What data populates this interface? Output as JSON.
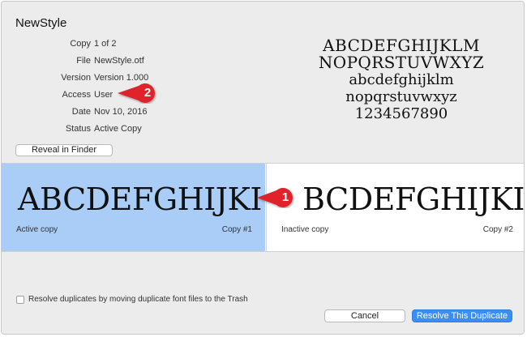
{
  "window": {
    "title": "NewStyle"
  },
  "info": {
    "rows": [
      {
        "label": "Copy",
        "value": "1 of 2"
      },
      {
        "label": "File",
        "value": "NewStyle.otf"
      },
      {
        "label": "Version",
        "value": "Version 1.000"
      },
      {
        "label": "Access",
        "value": "User"
      },
      {
        "label": "Date",
        "value": "Nov 10, 2016"
      },
      {
        "label": "Status",
        "value": "Active Copy"
      }
    ],
    "reveal_button": "Reveal in Finder"
  },
  "sample": {
    "lines": [
      "ABCDEFGHIJKLM",
      "NOPQRSTUVWXYZ",
      "abcdefghijklm",
      "nopqrstuvwxyz",
      "1234567890"
    ]
  },
  "panes": {
    "active": {
      "sample": "ABCDEFGHIJKI",
      "status": "Active copy",
      "copy": "Copy #1"
    },
    "inactive": {
      "sample": "BCDEFGHIJKI",
      "status": "Inactive copy",
      "copy": "Copy #2"
    }
  },
  "footer": {
    "checkbox_label": "Resolve duplicates by moving duplicate font files to the Trash",
    "checkbox_checked": false,
    "cancel_label": "Cancel",
    "resolve_label": "Resolve This Duplicate"
  },
  "callouts": [
    {
      "number": "1"
    },
    {
      "number": "2"
    }
  ],
  "colors": {
    "selected_pane": "#a9cdf6",
    "primary_button": "#3b8ef3",
    "callout": "#e0222a"
  }
}
